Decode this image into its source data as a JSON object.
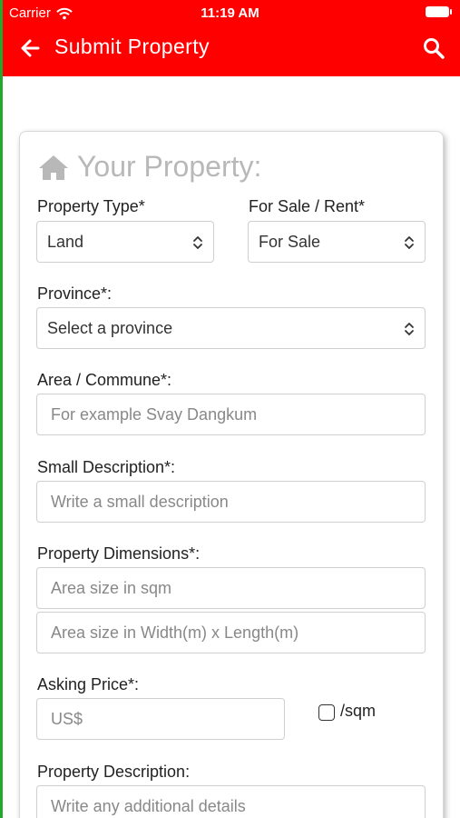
{
  "status_bar": {
    "carrier": "Carrier",
    "time": "11:19 AM"
  },
  "header": {
    "title": "Submit Property",
    "background_color": "#ff0000",
    "back_icon": "arrow-left-icon",
    "search_icon": "search-icon"
  },
  "form": {
    "section_title": "Your Property:",
    "section_icon": "home-icon",
    "property_type": {
      "label": "Property Type*",
      "value": "Land"
    },
    "sale_rent": {
      "label": "For Sale / Rent*",
      "value": "For Sale"
    },
    "province": {
      "label": "Province*:",
      "value": "Select a province"
    },
    "area_commune": {
      "label": "Area / Commune*:",
      "placeholder": "For example Svay Dangkum"
    },
    "small_description": {
      "label": "Small Description*:",
      "placeholder": "Write a small description"
    },
    "dimensions": {
      "label": "Property Dimensions*:",
      "area_placeholder": "Area size in sqm",
      "wl_placeholder": "Area size in Width(m) x Length(m)"
    },
    "asking_price": {
      "label": "Asking Price*:",
      "placeholder": "US$",
      "per_sqm_label": "/sqm"
    },
    "property_description": {
      "label": "Property Description:",
      "placeholder": "Write any additional details"
    }
  }
}
